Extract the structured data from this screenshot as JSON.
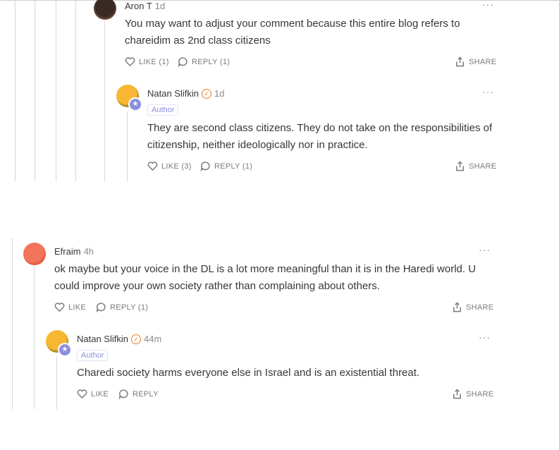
{
  "comments": [
    {
      "author": "Aron T",
      "time": "1d",
      "text_lines": [
        "You may want to adjust your comment because this entire blog refers to",
        "chareidim as 2nd class citizens"
      ],
      "like_label": "LIKE (1)",
      "reply_label": "REPLY (1)",
      "share_label": "SHARE",
      "more": "···"
    },
    {
      "author": "Natan Slifkin",
      "time": "1d",
      "tag": "Author",
      "text_lines": [
        "They are second class citizens. They do not take on the responsibilities of",
        "citizenship, neither ideologically nor in practice."
      ],
      "like_label": "LIKE (3)",
      "reply_label": "REPLY (1)",
      "share_label": "SHARE",
      "more": "···"
    },
    {
      "author": "Efraim",
      "time": "4h",
      "text_lines": [
        "ok maybe but your voice in the DL is a lot more meaningful than it is in the Haredi world. U",
        "could improve your own society rather than complaining about others."
      ],
      "like_label": "LIKE",
      "reply_label": "REPLY (1)",
      "share_label": "SHARE",
      "more": "···"
    },
    {
      "author": "Natan Slifkin",
      "time": "44m",
      "tag": "Author",
      "text_lines": [
        "Charedi society harms everyone else in Israel and is an existential threat."
      ],
      "like_label": "LIKE",
      "reply_label": "REPLY",
      "share_label": "SHARE",
      "more": "···"
    }
  ]
}
